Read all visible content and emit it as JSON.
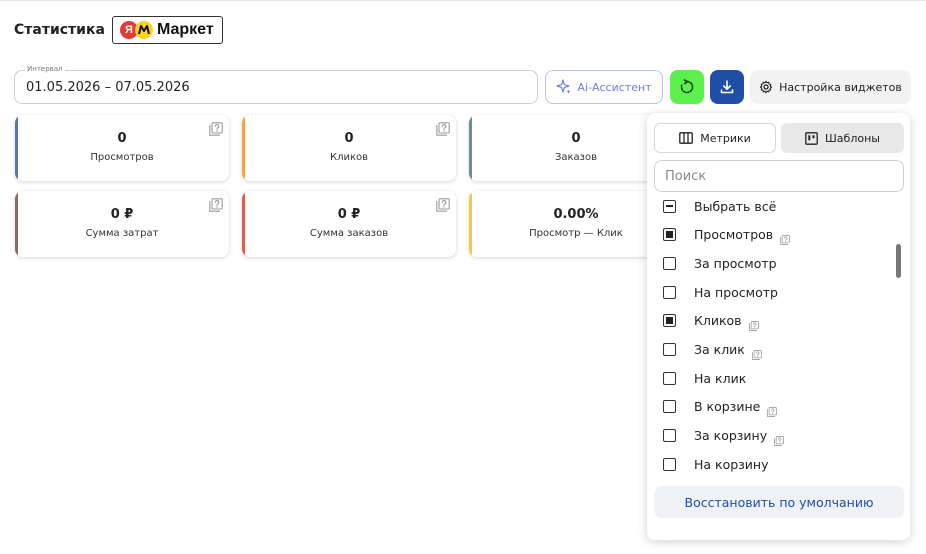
{
  "header": {
    "title": "Статистика",
    "badge": {
      "logo_letter": "Я",
      "text": "Маркет"
    }
  },
  "filters": {
    "interval_label": "Интервал",
    "interval_value": "01.05.2026 – 07.05.2026"
  },
  "toolbar": {
    "ai_label": "Ai-Ассистент",
    "widgets_label": "Настройка виджетов",
    "colors": {
      "refresh": "#5cf04d",
      "download": "#1f4fa6",
      "ai_text": "#6f80de"
    }
  },
  "cards": [
    {
      "value": "0",
      "label": "Просмотров",
      "color": "#5b74b7"
    },
    {
      "value": "0",
      "label": "Кликов",
      "color": "#f0a73a"
    },
    {
      "value": "0",
      "label": "Заказов",
      "color": "#6f8a99"
    },
    {
      "value": "0 ₽",
      "label": "Сумма затрат",
      "color": "#8a6a66"
    },
    {
      "value": "0 ₽",
      "label": "Сумма заказов",
      "color": "#e25d5a"
    },
    {
      "value": "0.00%",
      "label": "Просмотр — Клик",
      "color": "#f3c74b"
    }
  ],
  "widget_panel": {
    "tabs": [
      {
        "label": "Метрики",
        "active": false
      },
      {
        "label": "Шаблоны",
        "active": true
      }
    ],
    "search_placeholder": "Поиск",
    "items": [
      {
        "label": "Выбрать всё",
        "state": "partial",
        "help": false
      },
      {
        "label": "Просмотров",
        "state": "checked",
        "help": true
      },
      {
        "label": "За просмотр",
        "state": "unchecked",
        "help": false
      },
      {
        "label": "На просмотр",
        "state": "unchecked",
        "help": false
      },
      {
        "label": "Кликов",
        "state": "checked",
        "help": true
      },
      {
        "label": "За клик",
        "state": "unchecked",
        "help": true
      },
      {
        "label": "На клик",
        "state": "unchecked",
        "help": false
      },
      {
        "label": "В корзине",
        "state": "unchecked",
        "help": true
      },
      {
        "label": "За корзину",
        "state": "unchecked",
        "help": true
      },
      {
        "label": "На корзину",
        "state": "unchecked",
        "help": false
      }
    ],
    "restore_label": "Восстановить по умолчанию"
  }
}
